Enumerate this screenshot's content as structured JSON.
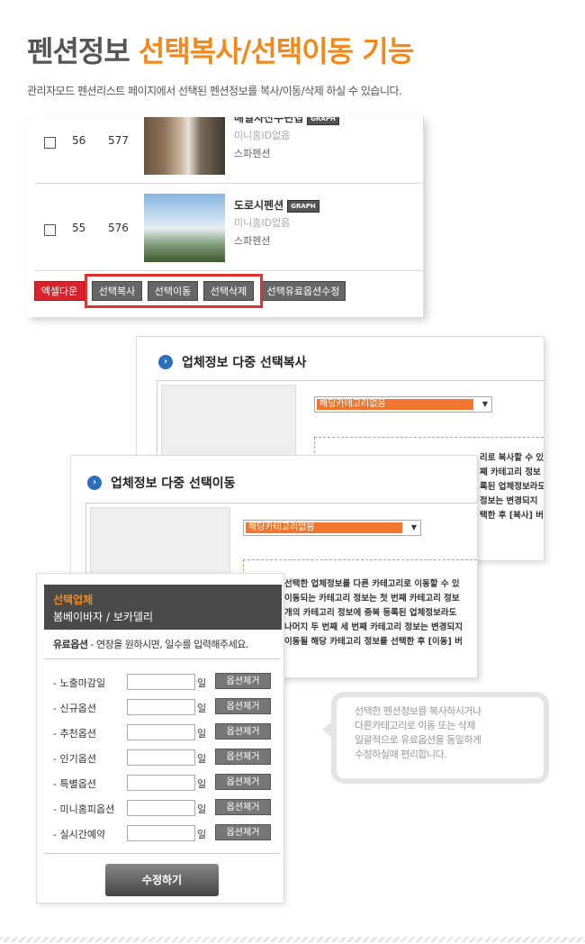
{
  "header": {
    "title_gray": "펜션정보 ",
    "title_orange": "선택복사/선택이동 기능",
    "subtitle": "관리자모드 펜션리스트 페이지에서 선택된 펜션정보를 복사/이동/삭제 하실 수 있습니다."
  },
  "list_panel": {
    "rows": [
      {
        "col1": "56",
        "col2": "577",
        "name": "매일자산수편집",
        "badge": "GRAPH",
        "sub1": "미니홈ID없음",
        "sub2": "스파펜션"
      },
      {
        "col1": "55",
        "col2": "576",
        "name": "도로시펜션",
        "badge": "GRAPH",
        "sub1": "미니홈ID없음",
        "sub2": "스파펜션"
      }
    ],
    "buttons": {
      "excel": "엑셀다운",
      "copy": "선택복사",
      "move": "선택이동",
      "delete": "선택삭제",
      "paid_edit": "선택유료옵션수정"
    }
  },
  "copy_panel": {
    "title": "업체정보 다중 선택복사",
    "select_value": "해당카테고리없음",
    "desc_lines": [
      "리로 복사할 수 있",
      "째 카테고리 정보",
      "록된 업체정보라도",
      "정보는 변경되지",
      "택한 후 [복사] 버"
    ]
  },
  "move_panel": {
    "title": "업체정보 다중 선택이동",
    "select_value": "해당카테고리없음",
    "desc_lines": [
      "선택한 업체정보를 다른 카테고리로 이동할 수 있",
      "이동되는 카테고리 정보는 첫 번째 카테고리 정보",
      "개의 카테고리 정보에 중복 등록된 업체정보라도",
      "나머지 두 번째 세 번째 카테고리 정보는 변경되지",
      "이동될 해당 카테고리 정보를 선택한 후 [이동] 버"
    ]
  },
  "option_panel": {
    "head_label": "선택업체",
    "head_name": "봄베이바자 / 보카델리",
    "option_title": "유료옵션",
    "option_desc": " - 연장을 원하시면, 일수를 입력해주세요.",
    "unit": "일",
    "remove_label": "옵션제거",
    "rows": [
      "- 노출마감일",
      "- 신규옵션",
      "- 추천옵션",
      "- 인기옵션",
      "- 특별옵션",
      "- 미니홈피옵션",
      "- 실시간예약"
    ],
    "submit": "수정하기"
  },
  "callout": {
    "lines": [
      "선택한 펜션정보를 복사하시거나",
      "다른카테고리로 이동 또는 삭제",
      "일괄적으로 유료옵션을 동일하게",
      "수정하실때 편리합니다."
    ]
  },
  "colors": {
    "accent": "#f08a1c",
    "danger": "#d7232b",
    "select": "#f2762d"
  }
}
